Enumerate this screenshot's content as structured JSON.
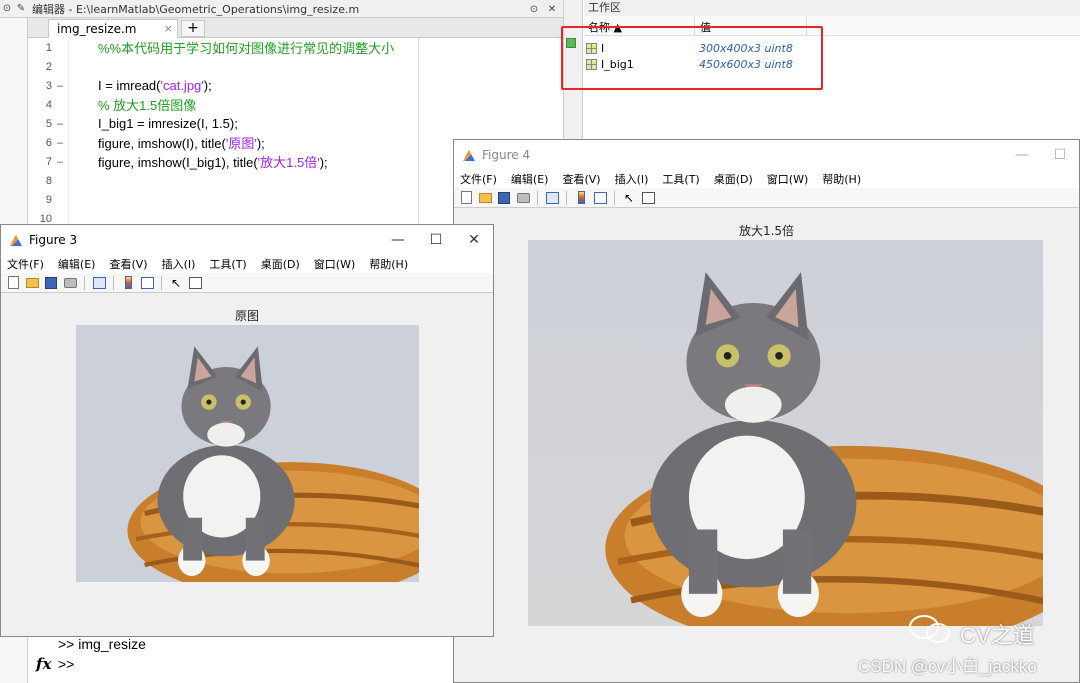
{
  "editor": {
    "title": "编辑器 - E:\\learnMatlab\\Geometric_Operations\\img_resize.m",
    "tab_label": "img_resize.m",
    "tab_close": "×",
    "tab_add": "+",
    "lines": [
      {
        "num": "1",
        "dash": "",
        "parts": [
          {
            "t": "%%本代码用于学习如何对图像进行常见的调整大小",
            "c": "cm"
          }
        ]
      },
      {
        "num": "2",
        "dash": "",
        "parts": []
      },
      {
        "num": "3",
        "dash": "–",
        "parts": [
          {
            "t": "I = imread(",
            "c": ""
          },
          {
            "t": "'cat.jpg'",
            "c": "str"
          },
          {
            "t": ");",
            "c": ""
          }
        ]
      },
      {
        "num": "4",
        "dash": "",
        "parts": [
          {
            "t": "% 放大1.5倍图像",
            "c": "cm"
          }
        ]
      },
      {
        "num": "5",
        "dash": "–",
        "parts": [
          {
            "t": "I_big1 = imresize(I, 1.5);",
            "c": ""
          }
        ]
      },
      {
        "num": "6",
        "dash": "–",
        "parts": [
          {
            "t": "figure, imshow(I), title(",
            "c": ""
          },
          {
            "t": "'原图'",
            "c": "str"
          },
          {
            "t": ");",
            "c": ""
          }
        ]
      },
      {
        "num": "7",
        "dash": "–",
        "parts": [
          {
            "t": "figure, imshow(I_big1), title(",
            "c": ""
          },
          {
            "t": "'放大1.5倍'",
            "c": "str"
          },
          {
            "t": ");",
            "c": ""
          }
        ]
      },
      {
        "num": "8",
        "dash": "",
        "parts": []
      },
      {
        "num": "9",
        "dash": "",
        "parts": []
      },
      {
        "num": "10",
        "dash": "",
        "parts": []
      }
    ]
  },
  "workspace": {
    "title": "工作区",
    "col_name": "名称 ▲",
    "col_value": "值",
    "vars": [
      {
        "name": "I",
        "value": "300x400x3 uint8"
      },
      {
        "name": "I_big1",
        "value": "450x600x3 uint8"
      }
    ],
    "highlight_color": "#e8262a"
  },
  "command": {
    "history": ">> img_resize",
    "prompt": ">>",
    "fx": "fx"
  },
  "figure3": {
    "name": "Figure 3",
    "menu": [
      "文件(F)",
      "编辑(E)",
      "查看(V)",
      "插入(I)",
      "工具(T)",
      "桌面(D)",
      "窗口(W)",
      "帮助(H)"
    ],
    "axes_title": "原图"
  },
  "figure4": {
    "name": "Figure 4",
    "menu": [
      "文件(F)",
      "编辑(E)",
      "查看(V)",
      "插入(I)",
      "工具(T)",
      "桌面(D)",
      "窗口(W)",
      "帮助(H)"
    ],
    "axes_title": "放大1.5倍"
  },
  "watermark": {
    "brand": "CV之道",
    "credit": "CSDN @cv小白_jackko"
  },
  "icons": {
    "minimize": "—",
    "maximize": "☐",
    "close": "✕"
  }
}
